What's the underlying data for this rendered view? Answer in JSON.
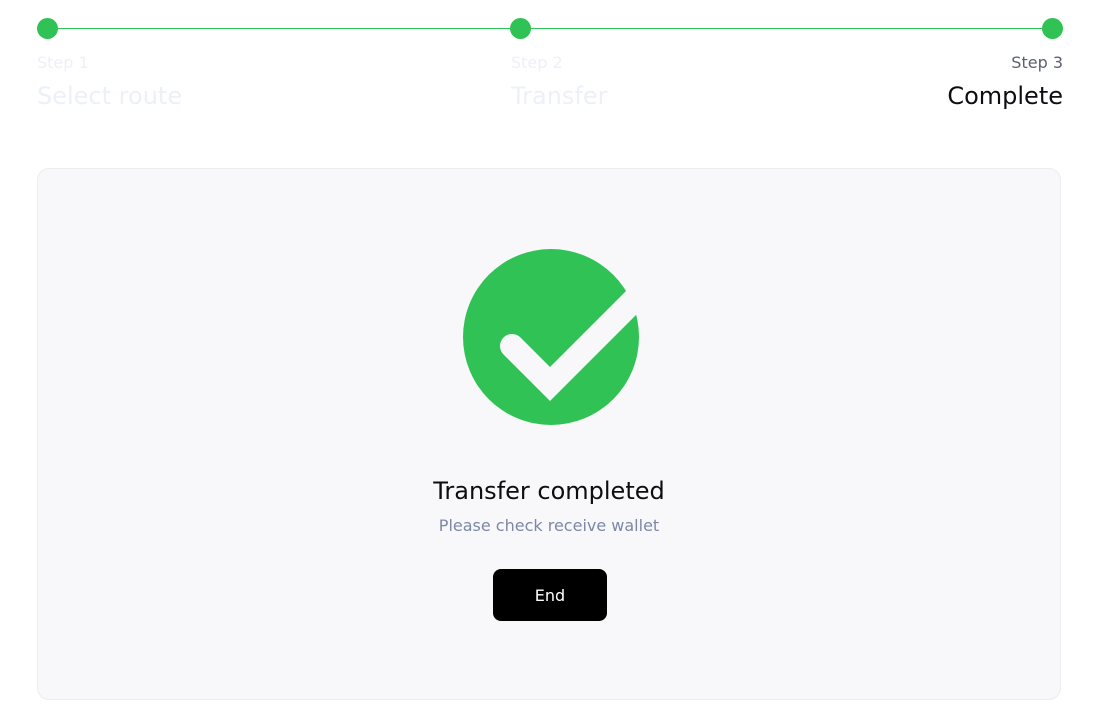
{
  "steps": [
    {
      "number": "Step 1",
      "title": "Select route"
    },
    {
      "number": "Step 2",
      "title": "Transfer"
    },
    {
      "number": "Step 3",
      "title": "Complete"
    }
  ],
  "current_step": 3,
  "result": {
    "icon": "check-circle-icon",
    "title": "Transfer completed",
    "subtitle": "Please check receive wallet",
    "button_label": "End"
  },
  "colors": {
    "accent": "#30c254",
    "button": "#000000",
    "muted_step_text": "#edf0f8",
    "subtitle": "#7d88a8"
  }
}
